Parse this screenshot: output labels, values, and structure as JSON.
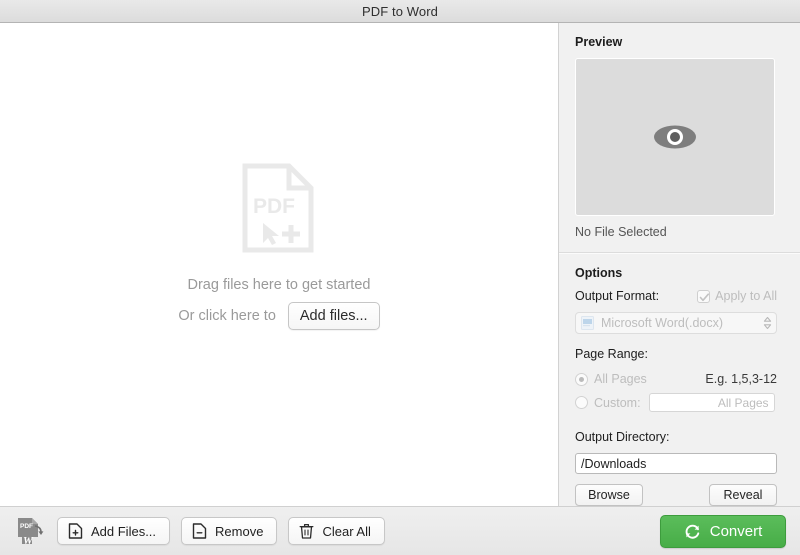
{
  "window": {
    "title": "PDF to Word"
  },
  "dropzone": {
    "icon": "pdf-add-file-icon",
    "icon_label": "PDF",
    "line1": "Drag files here to get started",
    "line2_prefix": "Or click here to",
    "add_files_label": "Add files..."
  },
  "preview": {
    "heading": "Preview",
    "icon": "eye-icon",
    "status": "No File Selected"
  },
  "options": {
    "heading": "Options",
    "output_format_label": "Output Format:",
    "apply_to_all_label": "Apply to All",
    "apply_to_all_checked": true,
    "apply_to_all_disabled": true,
    "format_select": {
      "icon": "word-document-icon",
      "value": "Microsoft Word(.docx)",
      "disabled": true
    },
    "page_range_label": "Page Range:",
    "all_pages_label": "All Pages",
    "all_pages_selected": true,
    "example_hint": "E.g. 1,5,3-12",
    "custom_label": "Custom:",
    "custom_selected": false,
    "custom_placeholder": "All Pages",
    "custom_value": ""
  },
  "output_directory": {
    "label": "Output Directory:",
    "value": "/Downloads",
    "browse_label": "Browse",
    "reveal_label": "Reveal"
  },
  "toolbar": {
    "logo": "pdf-to-word-logo",
    "add_files_label": "Add Files...",
    "add_files_icon": "file-plus-icon",
    "remove_label": "Remove",
    "remove_icon": "file-minus-icon",
    "clear_all_label": "Clear All",
    "clear_all_icon": "trash-icon",
    "convert_label": "Convert",
    "convert_icon": "refresh-circle-icon"
  },
  "colors": {
    "accent_green": "#4cae4c",
    "panel_background": "#f1f1f1",
    "preview_background": "#dcdcdc",
    "placeholder_gray": "#9a9a9a",
    "disabled_gray": "#bdbdbd"
  }
}
